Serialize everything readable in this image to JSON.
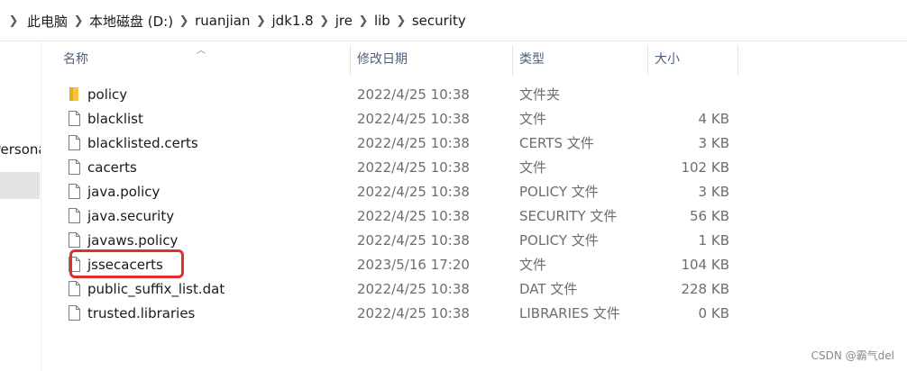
{
  "address": {
    "crumbs": [
      "此电脑",
      "本地磁盘 (D:)",
      "ruanjian",
      "jdk1.8",
      "jre",
      "lib",
      "security"
    ]
  },
  "nav": {
    "partial_item": "Persona"
  },
  "columns": {
    "name": "名称",
    "date": "修改日期",
    "type": "类型",
    "size": "大小"
  },
  "files": [
    {
      "name": "policy",
      "date": "2022/4/25 10:38",
      "type": "文件夹",
      "size": "",
      "icon": "folder-icon"
    },
    {
      "name": "blacklist",
      "date": "2022/4/25 10:38",
      "type": "文件",
      "size": "4 KB",
      "icon": "file-icon"
    },
    {
      "name": "blacklisted.certs",
      "date": "2022/4/25 10:38",
      "type": "CERTS 文件",
      "size": "3 KB",
      "icon": "file-icon"
    },
    {
      "name": "cacerts",
      "date": "2022/4/25 10:38",
      "type": "文件",
      "size": "102 KB",
      "icon": "file-icon"
    },
    {
      "name": "java.policy",
      "date": "2022/4/25 10:38",
      "type": "POLICY 文件",
      "size": "3 KB",
      "icon": "file-icon"
    },
    {
      "name": "java.security",
      "date": "2022/4/25 10:38",
      "type": "SECURITY 文件",
      "size": "56 KB",
      "icon": "file-icon"
    },
    {
      "name": "javaws.policy",
      "date": "2022/4/25 10:38",
      "type": "POLICY 文件",
      "size": "1 KB",
      "icon": "file-icon"
    },
    {
      "name": "jssecacerts",
      "date": "2023/5/16 17:20",
      "type": "文件",
      "size": "104 KB",
      "icon": "file-icon"
    },
    {
      "name": "public_suffix_list.dat",
      "date": "2022/4/25 10:38",
      "type": "DAT 文件",
      "size": "228 KB",
      "icon": "file-icon"
    },
    {
      "name": "trusted.libraries",
      "date": "2022/4/25 10:38",
      "type": "LIBRARIES 文件",
      "size": "0 KB",
      "icon": "file-icon"
    }
  ],
  "highlight_color": "#e0302e",
  "watermark": "CSDN @霸气del"
}
